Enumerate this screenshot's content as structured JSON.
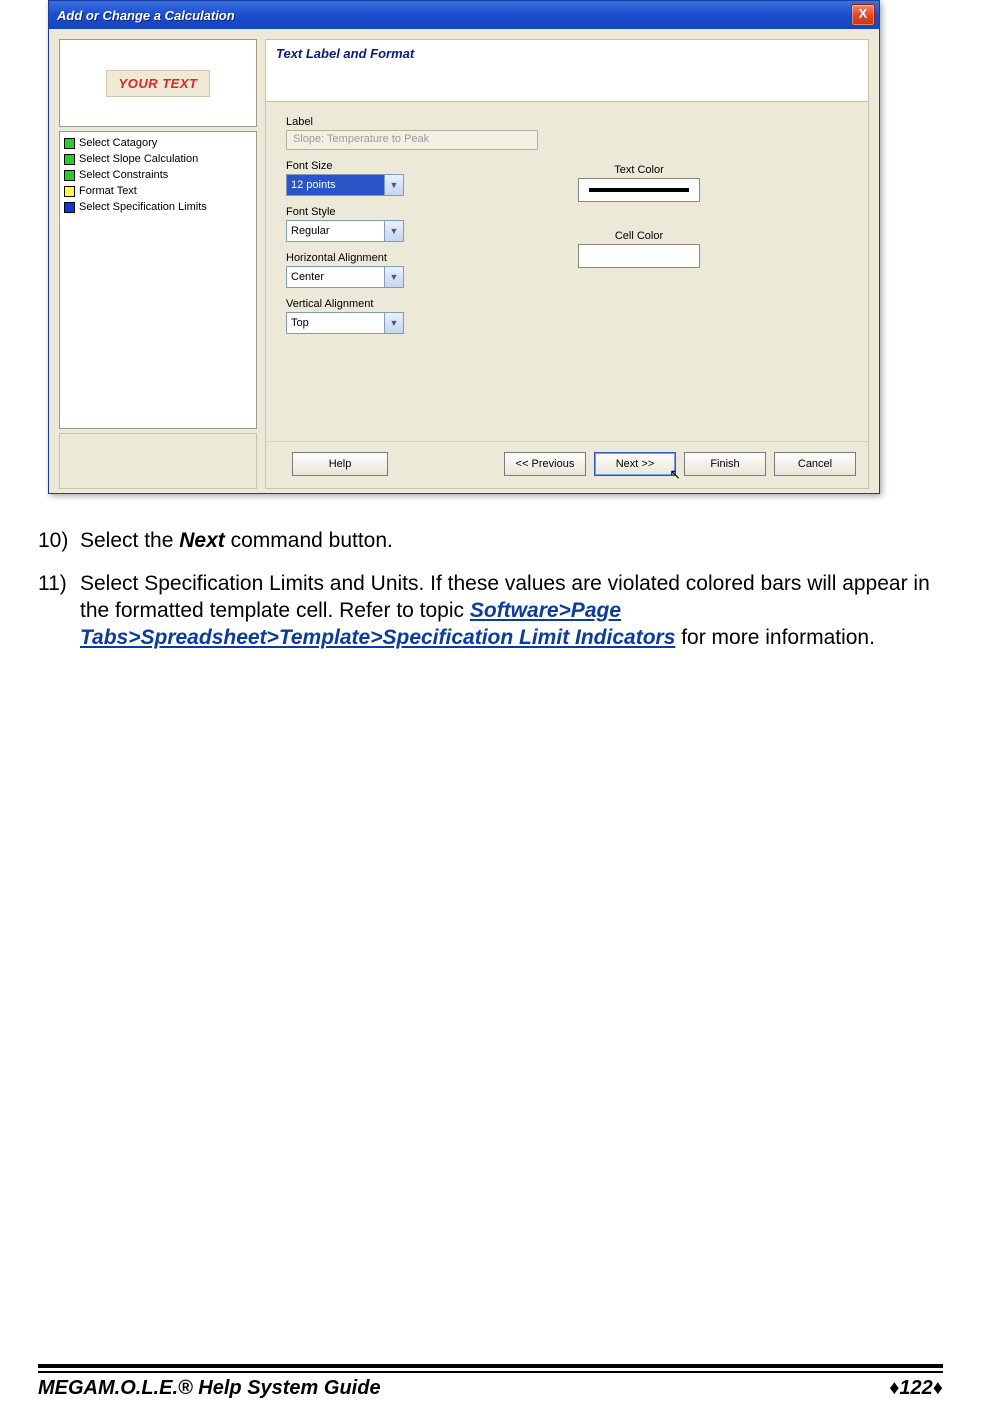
{
  "dialog": {
    "title": "Add or Change a Calculation",
    "close": "X",
    "preview_text": "YOUR TEXT",
    "steps": [
      {
        "color": "g",
        "label": "Select Catagory"
      },
      {
        "color": "g",
        "label": "Select Slope Calculation"
      },
      {
        "color": "g",
        "label": "Select Constraints"
      },
      {
        "color": "y",
        "label": "Format Text"
      },
      {
        "color": "b",
        "label": "Select Specification Limits"
      }
    ],
    "panel_title": "Text Label and Format",
    "fields": {
      "label_caption": "Label",
      "label_value": "Slope: Temperature to Peak",
      "fontsize_caption": "Font Size",
      "fontsize_value": "12 points",
      "fontstyle_caption": "Font Style",
      "fontstyle_value": "Regular",
      "halign_caption": "Horizontal Alignment",
      "halign_value": "Center",
      "valign_caption": "Vertical Alignment",
      "valign_value": "Top",
      "textcolor_caption": "Text Color",
      "cellcolor_caption": "Cell Color"
    },
    "buttons": {
      "help": "Help",
      "prev": "<< Previous",
      "next": "Next >>",
      "finish": "Finish",
      "cancel": "Cancel"
    }
  },
  "instructions": {
    "i10_num": "10)",
    "i10_a": "Select the ",
    "i10_b": "Next",
    "i10_c": " command button.",
    "i11_num": "11)",
    "i11_a": "Select Specification Limits and Units. If these values are violated colored bars will appear in the formatted template cell. Refer to  topic ",
    "i11_link": "Software>Page Tabs>Spreadsheet>Template>Specification Limit Indicators",
    "i11_b": " for more information."
  },
  "footer": {
    "left_b": "MEGA",
    "left_rest": "M.O.L.E.® Help System Guide",
    "page": "122",
    "dia": "♦"
  }
}
